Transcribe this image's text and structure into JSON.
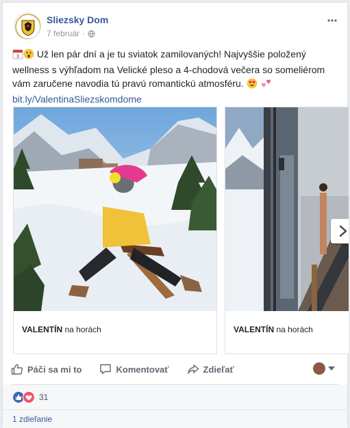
{
  "post": {
    "page_name": "Sliezsky Dom",
    "date": "7 február",
    "text_main": "Už len pár dní a je tu sviatok zamilovaných! Najvyššie položený wellness s výhľadom na Velické pleso a 4-chodová večera so someliérom vám zaručene navodia tú pravú romantickú atmosféru.",
    "calendar_day": "3",
    "link": "bit.ly/ValentinaSliezskomdome"
  },
  "carousel": {
    "slides": [
      {
        "caption_bold": "VALENTÍN",
        "caption_rest": " na horách"
      },
      {
        "caption_bold": "VALENTÍN",
        "caption_rest": " na horách"
      }
    ]
  },
  "actions": {
    "like_label": "Páči sa mi to",
    "comment_label": "Komentovať",
    "share_label": "Zdieľať"
  },
  "stats": {
    "reaction_count": "31",
    "shares_text": "1 zdieľanie"
  },
  "colors": {
    "link": "#365899",
    "like_blue": "#4267b2",
    "love_red": "#f25268"
  }
}
